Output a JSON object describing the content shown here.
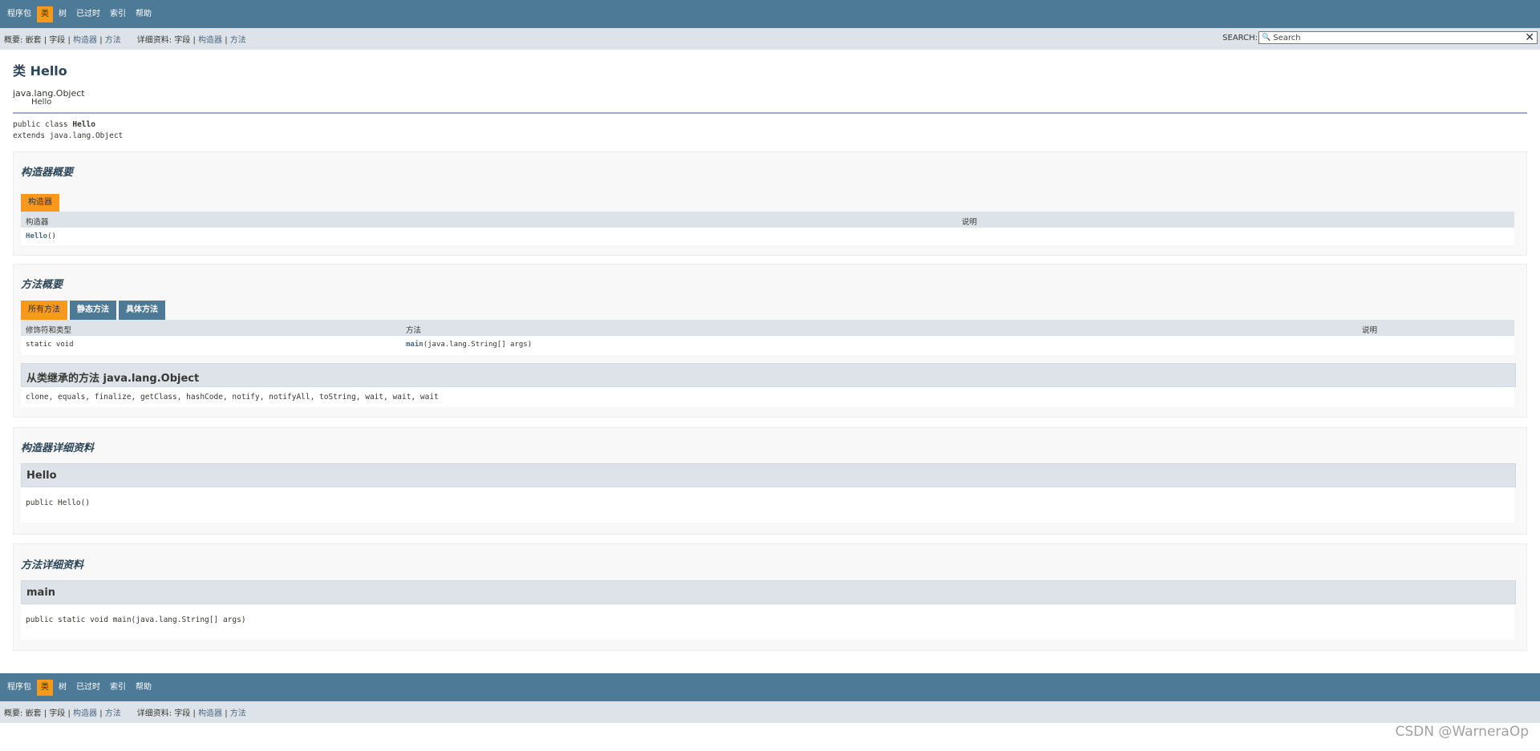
{
  "top_nav": {
    "items": [
      "程序包",
      "类",
      "树",
      "已过时",
      "索引",
      "帮助"
    ],
    "active_index": 1
  },
  "sub_nav": {
    "summary_prefix": "概要:",
    "summary_items": [
      "嵌套",
      "字段",
      "构造器",
      "方法"
    ],
    "detail_prefix": "详细资料:",
    "detail_items": [
      "字段",
      "构造器",
      "方法"
    ],
    "search_label": "SEARCH:",
    "search_placeholder": "Search"
  },
  "page": {
    "title": "类 Hello",
    "inheritance": [
      "java.lang.Object",
      "Hello"
    ],
    "declaration_prefix": "public class ",
    "declaration_name": "Hello",
    "declaration_extends": "extends java.lang.Object"
  },
  "constructor_summary": {
    "heading": "构造器概要",
    "tab": "构造器",
    "columns": [
      "构造器",
      "说明"
    ],
    "row_name": "Hello",
    "row_params": "()"
  },
  "method_summary": {
    "heading": "方法概要",
    "tabs": [
      "所有方法",
      "静态方法",
      "具体方法"
    ],
    "columns": [
      "修饰符和类型",
      "方法",
      "说明"
    ],
    "row_modifier": "static void",
    "row_name": "main",
    "row_params": "(java.lang.String[]  args)",
    "inherited_heading": "从类继承的方法 java.lang.Object",
    "inherited_methods": "clone, equals, finalize, getClass, hashCode, notify, notifyAll, toString, wait, wait, wait"
  },
  "constructor_detail": {
    "heading": "构造器详细资料",
    "name": "Hello",
    "signature": "public  Hello()"
  },
  "method_detail": {
    "heading": "方法详细资料",
    "name": "main",
    "signature": "public static  void  main(java.lang.String[]  args)"
  },
  "watermark": "CSDN @WarneraOp",
  "colors": {
    "nav_bg": "#4d7a97",
    "active_tab": "#f8981d",
    "subnav_bg": "#dee3e9",
    "block_bg": "#f8f8f8"
  }
}
